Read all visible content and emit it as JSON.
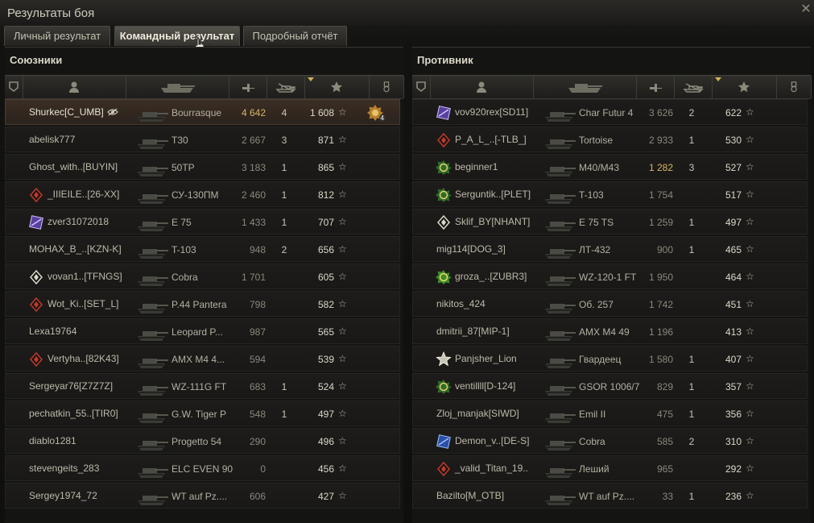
{
  "window": {
    "title": "Результаты боя",
    "close_icon": "close-icon"
  },
  "tabs": [
    {
      "label": "Личный результат",
      "active": false
    },
    {
      "label": "Командный результат",
      "active": true
    },
    {
      "label": "Подробный отчёт",
      "active": false
    }
  ],
  "columns": [
    "rank-icon",
    "player-icon",
    "tank-icon",
    "damage-icon",
    "kills-icon",
    "xp-star-icon",
    "medal-icon"
  ],
  "allies": {
    "title": "Союзники",
    "rows": [
      {
        "name": "Shurkec[C_UMB]",
        "badge": "",
        "tank": "Bourrasque",
        "damage": "4 642",
        "kills": "4",
        "xp": "1 608",
        "me": true,
        "medal": "4"
      },
      {
        "name": "abelisk777",
        "badge": "",
        "tank": "T30",
        "damage": "2 667",
        "kills": "3",
        "xp": "871"
      },
      {
        "name": "Ghost_with..[BUYIN]",
        "badge": "",
        "tank": "50TP",
        "damage": "3 183",
        "kills": "1",
        "xp": "865"
      },
      {
        "name": "_IIIEILE..[26-XX]",
        "badge": "diamond",
        "tank": "СУ-130ПМ",
        "damage": "2 460",
        "kills": "1",
        "xp": "812"
      },
      {
        "name": "zver31072018",
        "badge": "purple",
        "tank": "E 75",
        "damage": "1 433",
        "kills": "1",
        "xp": "707"
      },
      {
        "name": "MOHAX_B_..[KZN-K]",
        "badge": "",
        "tank": "T-103",
        "damage": "948",
        "kills": "2",
        "xp": "656"
      },
      {
        "name": "vovan1..[TFNGS]",
        "badge": "diamond-white",
        "tank": "Cobra",
        "damage": "1 701",
        "kills": "",
        "xp": "605"
      },
      {
        "name": "Wot_Ki..[SET_L]",
        "badge": "diamond",
        "tank": "P.44 Pantera",
        "damage": "798",
        "kills": "",
        "xp": "582"
      },
      {
        "name": "Lexa19764",
        "badge": "",
        "tank": "Leopard P...",
        "damage": "987",
        "kills": "",
        "xp": "565"
      },
      {
        "name": "Vertyha..[82K43]",
        "badge": "diamond",
        "tank": "AMX M4 4...",
        "damage": "594",
        "kills": "",
        "xp": "539"
      },
      {
        "name": "Sergeyar76[Z7Z7Z]",
        "badge": "",
        "tank": "WZ-111G FT",
        "damage": "683",
        "kills": "1",
        "xp": "524"
      },
      {
        "name": "pechatkin_55..[TIR0]",
        "badge": "",
        "tank": "G.W. Tiger P",
        "damage": "548",
        "kills": "1",
        "xp": "497"
      },
      {
        "name": "diablo1281",
        "badge": "",
        "tank": "Progetto 54",
        "damage": "290",
        "kills": "",
        "xp": "496"
      },
      {
        "name": "stevengeits_283",
        "badge": "",
        "tank": "ELC EVEN 90",
        "damage": "0",
        "kills": "",
        "xp": "456"
      },
      {
        "name": "Sergey1974_72",
        "badge": "",
        "tank": "WT auf Pz....",
        "damage": "606",
        "kills": "",
        "xp": "427"
      }
    ]
  },
  "enemies": {
    "title": "Противник",
    "rows": [
      {
        "name": "vov920rex[SD11]",
        "badge": "purple",
        "tank": "Char Futur 4",
        "damage": "3 626",
        "kills": "2",
        "xp": "622"
      },
      {
        "name": "P_A_L_..[-TLB_]",
        "badge": "diamond",
        "tank": "Tortoise",
        "damage": "2 933",
        "kills": "1",
        "xp": "530"
      },
      {
        "name": "beginner1",
        "badge": "green",
        "tank": "M40/M43",
        "damage": "1 282",
        "kills": "3",
        "xp": "527",
        "lit": true
      },
      {
        "name": "Serguntik..[PLET]",
        "badge": "green",
        "tank": "T-103",
        "damage": "1 754",
        "kills": "",
        "xp": "517"
      },
      {
        "name": "Sklif_BY[NHANT]",
        "badge": "diamond-white",
        "tank": "E 75 TS",
        "damage": "1 259",
        "kills": "1",
        "xp": "497"
      },
      {
        "name": "mig114[DOG_3]",
        "badge": "",
        "tank": "ЛТ-432",
        "damage": "900",
        "kills": "1",
        "xp": "465"
      },
      {
        "name": "groza_..[ZUBR3]",
        "badge": "greenyellow",
        "tank": "WZ-120-1 FT",
        "damage": "1 950",
        "kills": "",
        "xp": "464"
      },
      {
        "name": "nikitos_424",
        "badge": "",
        "tank": "Об. 257",
        "damage": "1 742",
        "kills": "",
        "xp": "451"
      },
      {
        "name": "dmitrii_87[MIP-1]",
        "badge": "",
        "tank": "AMX M4 49",
        "damage": "1 196",
        "kills": "",
        "xp": "413"
      },
      {
        "name": "Panjsher_Lion",
        "badge": "white-star",
        "tank": "Гвардеец",
        "damage": "1 580",
        "kills": "1",
        "xp": "407"
      },
      {
        "name": "ventillll[D-124]",
        "badge": "green",
        "tank": "GSOR 1006/7",
        "damage": "829",
        "kills": "1",
        "xp": "357"
      },
      {
        "name": "Zloj_manjak[SIWD]",
        "badge": "",
        "tank": "Emil II",
        "damage": "475",
        "kills": "1",
        "xp": "356"
      },
      {
        "name": "Demon_v..[DE-S]",
        "badge": "blue",
        "tank": "Cobra",
        "damage": "585",
        "kills": "2",
        "xp": "310"
      },
      {
        "name": "_valid_Titan_19..",
        "badge": "diamond",
        "tank": "Леший",
        "damage": "965",
        "kills": "",
        "xp": "292"
      },
      {
        "name": "Bazilto[M_OTB]",
        "badge": "",
        "tank": "WT auf Pz....",
        "damage": "33",
        "kills": "1",
        "xp": "236"
      }
    ]
  },
  "star_glyph": "☆"
}
